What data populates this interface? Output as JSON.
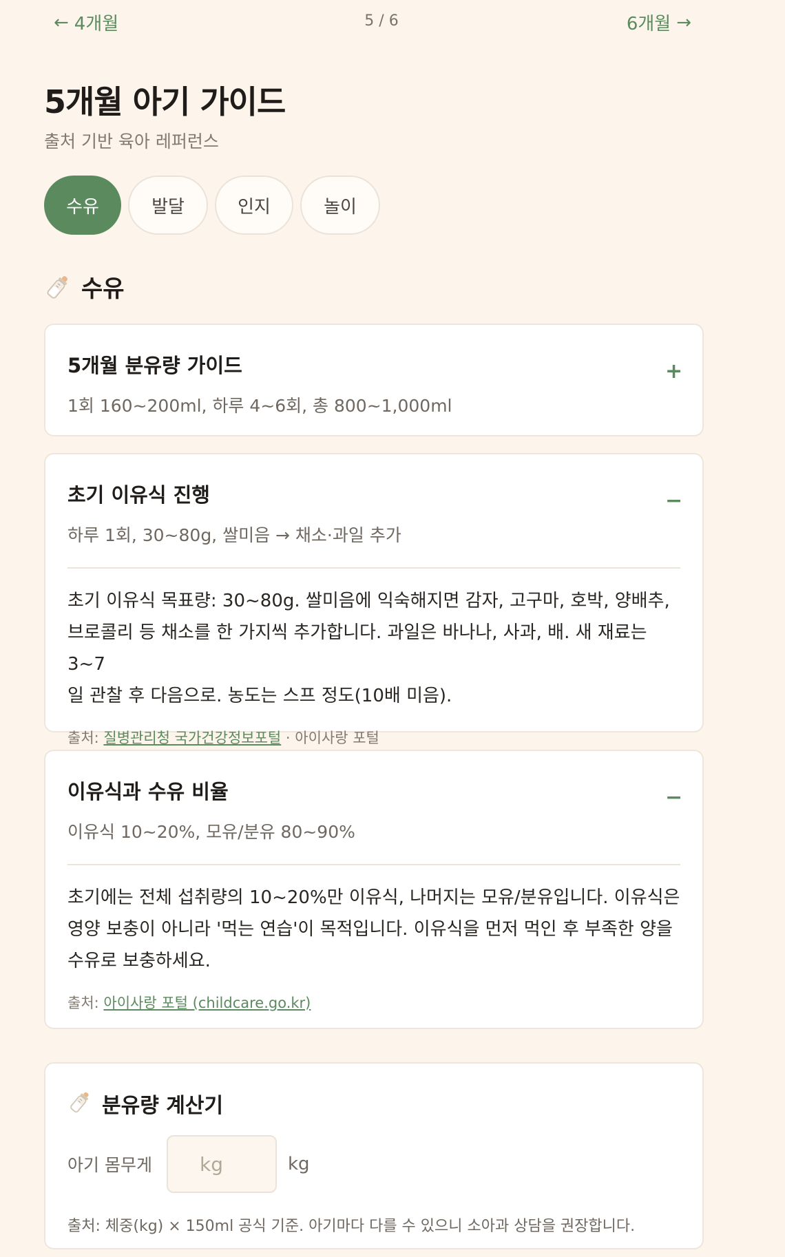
{
  "nav": {
    "prev_label": "4개월",
    "next_label": "6개월",
    "page_indicator": "5 / 6"
  },
  "header": {
    "title": "5개월 아기 가이드",
    "subtitle": "출처 기반 육아 레퍼런스"
  },
  "tabs": [
    {
      "label": "수유",
      "active": true
    },
    {
      "label": "발달",
      "active": false
    },
    {
      "label": "인지",
      "active": false
    },
    {
      "label": "놀이",
      "active": false
    }
  ],
  "section": {
    "icon": "baby-bottle-icon",
    "heading": "수유"
  },
  "cards": [
    {
      "title": "5개월 분유량 가이드",
      "summary": "1회 160~200ml, 하루 4~6회, 총 800~1,000ml",
      "toggle": "+",
      "expanded": false
    },
    {
      "title": "초기 이유식 진행",
      "summary": "하루 1회, 30~80g, 쌀미음 → 채소·과일 추가",
      "toggle": "−",
      "expanded": true,
      "body_lines": [
        "초기 이유식 목표량: 30~80g. 쌀미음에 익숙해지면 감자, 고구마, 호박, 양배추,",
        "브로콜리 등 채소를 한 가지씩 추가합니다. 과일은 바나나, 사과, 배. 새 재료는 3~7",
        "일 관찰 후 다음으로. 농도는 스프 정도(10배 미음)."
      ],
      "source_prefix": "출처: ",
      "source_link": "질병관리청 국가건강정보포털",
      "source_suffix": " · 아이사랑 포털"
    },
    {
      "title": "이유식과 수유 비율",
      "summary": "이유식 10~20%, 모유/분유 80~90%",
      "toggle": "−",
      "expanded": true,
      "body_lines": [
        "초기에는 전체 섭취량의 10~20%만 이유식, 나머지는 모유/분유입니다. 이유식은",
        "영양 보충이 아니라 '먹는 연습'이 목적입니다. 이유식을 먼저 먹인 후 부족한 양을",
        "수유로 보충하세요."
      ],
      "source_prefix": "출처: ",
      "source_link": "아이사랑 포털 (childcare.go.kr)",
      "source_suffix": ""
    }
  ],
  "calculator": {
    "icon": "baby-bottle-icon",
    "title": "분유량 계산기",
    "weight_label": "아기 몸무게",
    "input_value": "",
    "input_placeholder": "kg",
    "unit": "kg",
    "note": "출처: 체중(kg) × 150ml 공식 기준. 아기마다 다를 수 있으니 소아과 상담을 권장합니다."
  },
  "colors": {
    "accent": "#5b8a5e",
    "background": "#fdf5ec",
    "card": "#ffffff"
  }
}
